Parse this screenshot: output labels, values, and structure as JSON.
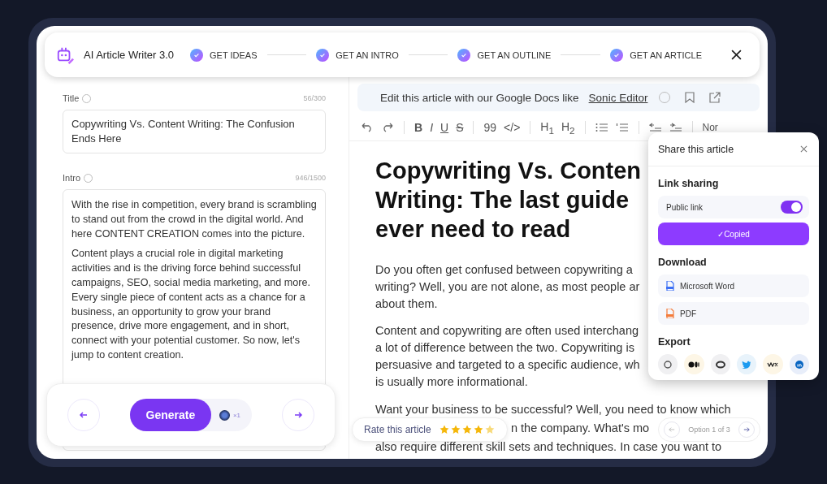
{
  "app": {
    "name": "AI Article Writer 3.0"
  },
  "steps": [
    {
      "label": "GET IDEAS",
      "done": true
    },
    {
      "label": "GET AN INTRO",
      "done": true
    },
    {
      "label": "GET AN OUTLINE",
      "done": true
    },
    {
      "label": "GET AN ARTICLE",
      "done": true
    }
  ],
  "title_field": {
    "label": "Title",
    "count": "56/300",
    "value": "Copywriting Vs. Content Writing: The Confusion Ends Here"
  },
  "intro_field": {
    "label": "Intro",
    "count": "946/1500",
    "paragraphs": [
      "With the rise in competition, every brand is scrambling to stand out from the crowd in the digital world. And here CONTENT CREATION comes into the picture.",
      "Content plays a crucial role in digital marketing activities and is the driving force behind successful campaigns, SEO, social media marketing, and more. Every single piece of content acts as a chance for a business, an opportunity to grow your brand presence, drive more engagement, and in short, connect with your potential customer. So now, let's jump to content creation."
    ]
  },
  "generate": {
    "label": "Generate",
    "credits": "×1"
  },
  "banner": {
    "text": "Edit this article with our Google Docs like",
    "link": "Sonic Editor"
  },
  "toolbar": {
    "format": [
      "B",
      "I",
      "U",
      "S"
    ],
    "blocks": [
      "99",
      "</>"
    ],
    "headings": [
      "H$_{1}$",
      "H$_{2}$"
    ],
    "style": "Nor"
  },
  "article": {
    "heading_lines": [
      "Copywriting Vs. Conten",
      "Writing: The last guide",
      "ever need to read"
    ],
    "paragraphs": [
      [
        "Do you often get confused between copywriting a",
        "writing? Well, you are not alone, as most people ar",
        "about them."
      ],
      [
        "Content and copywriting are often used interchang",
        "a lot of difference between the two. Copywriting is",
        "persuasive and targeted to a specific audience, wh",
        "is usually more informational."
      ],
      [
        "Want your business to be successful? Well, you need to know which",
        "n the company. What's mo",
        "also require different skill sets and techniques. In case you want to"
      ]
    ]
  },
  "rating": {
    "label": "Rate this article",
    "stars": 4
  },
  "pager": {
    "label": "Option 1 of 3"
  },
  "share": {
    "title": "Share this article",
    "link_heading": "Link sharing",
    "public_link": {
      "label": "Public link",
      "on": true
    },
    "copy_button": "✓Copied",
    "download_heading": "Download",
    "downloads": [
      {
        "kind": "doc",
        "label": "Microsoft Word"
      },
      {
        "kind": "pdf",
        "label": "PDF"
      }
    ],
    "export_heading": "Export"
  }
}
